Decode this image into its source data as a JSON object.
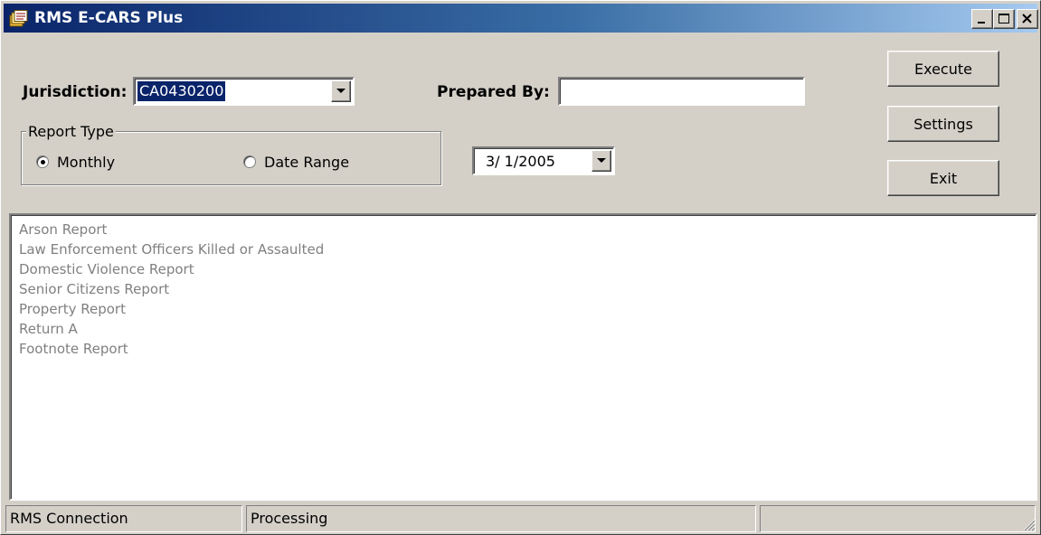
{
  "window": {
    "title": "RMS E-CARS Plus",
    "app_icon": "rms-app-icon"
  },
  "titlebar_buttons": [
    "minimize",
    "maximize",
    "close"
  ],
  "jurisdiction": {
    "label": "Jurisdiction:",
    "selected_value": "CA0430200"
  },
  "prepared_by": {
    "label": "Prepared By:",
    "value": ""
  },
  "report_type": {
    "title": "Report Type",
    "options": [
      {
        "label": "Monthly",
        "selected": true
      },
      {
        "label": "Date Range",
        "selected": false
      }
    ]
  },
  "date_picker": {
    "value": "3/ 1/2005"
  },
  "buttons": {
    "execute": "Execute",
    "settings": "Settings",
    "exit": "Exit"
  },
  "report_list": [
    "Arson Report",
    "Law Enforcement Officers Killed or Assaulted",
    "Domestic Violence Report",
    "Senior Citizens Report",
    "Property Report",
    "Return A",
    "Footnote Report"
  ],
  "status_bar": {
    "panel1": "RMS Connection",
    "panel2": "Processing",
    "panel3": ""
  },
  "colors": {
    "titlebar_start": "#0a246a",
    "titlebar_end": "#a6caf0",
    "window_face": "#d4d0c8",
    "selection": "#0a246a",
    "disabled_text": "#808080"
  }
}
